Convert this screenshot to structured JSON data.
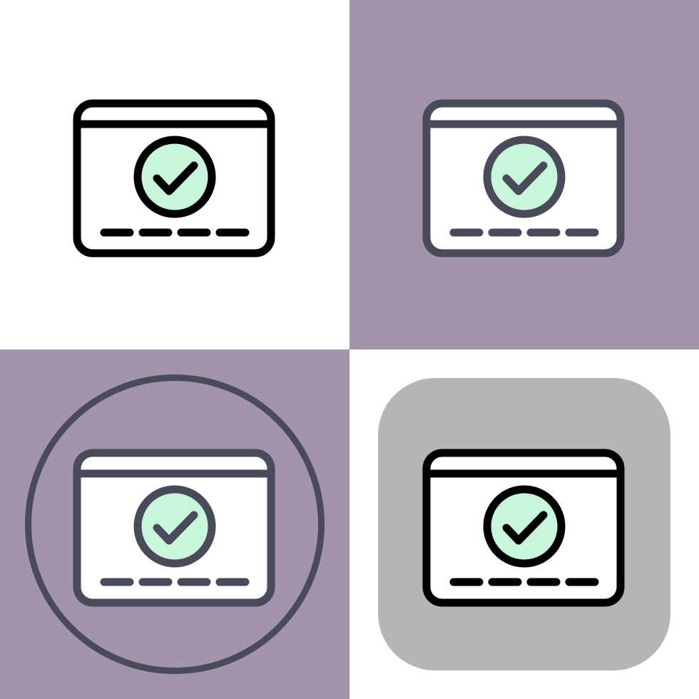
{
  "colors": {
    "white": "#ffffff",
    "purple_bg": "#a294ad",
    "gray_tile": "#b5b5b5",
    "black_stroke": "#000000",
    "slate_stroke": "#494a5a",
    "check_fill": "#c8f5dc",
    "card_fill": "#ffffff"
  },
  "variants": [
    {
      "name": "outline-black-on-white",
      "background": "#ffffff",
      "frame": "none",
      "stroke": "#000000"
    },
    {
      "name": "outline-slate-on-purple",
      "background": "#a294ad",
      "frame": "none",
      "stroke": "#494a5a"
    },
    {
      "name": "outline-slate-in-circle-on-purple",
      "background": "#a294ad",
      "frame": "circle",
      "stroke": "#494a5a"
    },
    {
      "name": "outline-black-on-gray-rounded-tile",
      "background": "#ffffff",
      "frame": "rounded-square",
      "stroke": "#000000"
    }
  ],
  "icon": {
    "name": "verified-card-icon",
    "dash_count": 4
  }
}
